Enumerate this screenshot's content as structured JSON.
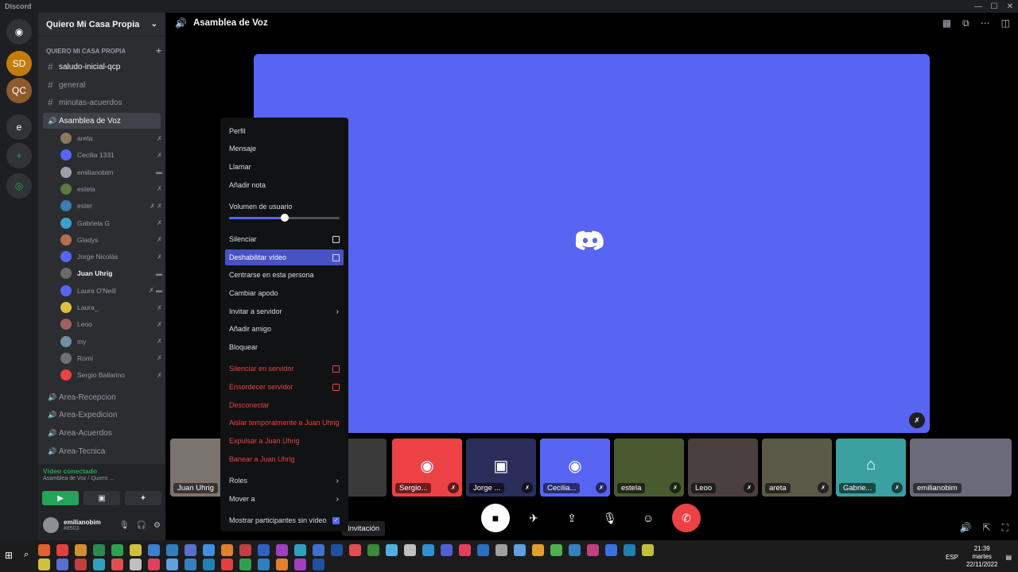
{
  "window": {
    "title": "Discord",
    "controls": [
      "—",
      "☐",
      "✕"
    ]
  },
  "guilds": [
    {
      "name": "discord-home",
      "glyph": "◉",
      "color": "#313338"
    },
    {
      "name": "server-a",
      "glyph": "SD",
      "color": "#c27c0e"
    },
    {
      "name": "server-quiero-mi-casa",
      "glyph": "QC",
      "color": "#8e5a2e"
    },
    {
      "name": "server-e",
      "glyph": "e",
      "color": "#313338"
    },
    {
      "name": "add-server",
      "glyph": "+",
      "color": "#313338"
    },
    {
      "name": "explore",
      "glyph": "◎",
      "color": "#313338"
    }
  ],
  "server": {
    "name": "Quiero Mi Casa Propia",
    "category": "QUIERO MI CASA PROPIA"
  },
  "channels": [
    {
      "name": "saludo-inicial-qcp",
      "type": "text",
      "bright": true
    },
    {
      "name": "general",
      "type": "text"
    },
    {
      "name": "minutas-acuerdos",
      "type": "text"
    },
    {
      "name": "Asamblea de Voz",
      "type": "voice",
      "active": true
    }
  ],
  "voice_users": [
    {
      "name": "areta",
      "icon": "✗",
      "color": "#8a7a60"
    },
    {
      "name": "Cecilia 1331",
      "icon": "✗",
      "color": "#5865f2"
    },
    {
      "name": "emilianobim",
      "icon": "▬",
      "color": "#9aa0a6"
    },
    {
      "name": "estela",
      "icon": "✗",
      "color": "#5a7a40"
    },
    {
      "name": "ester",
      "icon": "✗ ✗",
      "color": "#3a7fb0"
    },
    {
      "name": "Gabriela G",
      "icon": "✗",
      "color": "#3aa0d0"
    },
    {
      "name": "Gladys",
      "icon": "✗",
      "color": "#b07050"
    },
    {
      "name": "Jorge Nicolás",
      "icon": "✗",
      "color": "#5865f2"
    },
    {
      "name": "Juan Uhrig",
      "icon": "▬",
      "color": "#6a6a6a",
      "bright": true
    },
    {
      "name": "Laura O'Neill",
      "icon": "✗ ▬",
      "color": "#5865f2"
    },
    {
      "name": "Laura_",
      "icon": "✗",
      "color": "#e0c040"
    },
    {
      "name": "Leoo",
      "icon": "✗",
      "color": "#a06060"
    },
    {
      "name": "my",
      "icon": "✗",
      "color": "#7090a0"
    },
    {
      "name": "Romi",
      "icon": "✗",
      "color": "#707070"
    },
    {
      "name": "Sergio Ballarino",
      "icon": "✗",
      "color": "#ed4245"
    }
  ],
  "voice_channels": [
    "Area-Recepcion",
    "Area-Expedicion",
    "Area-Acuerdos",
    "Area-Tecnica"
  ],
  "voice_status": {
    "label": "Vídeo conectado",
    "sub": "Asamblea de Voz / Quiero ..."
  },
  "user": {
    "name": "emilianobim",
    "tag": "#8503"
  },
  "main": {
    "channel_title": "Asamblea de Voz",
    "invite_label": "Invitación"
  },
  "tiles": [
    {
      "label": "Juan Uhrig",
      "bg": "#7a7470",
      "glyph": ""
    },
    {
      "label": "...",
      "bg": "#3a3a3a",
      "glyph": ""
    },
    {
      "label": "Sergio...",
      "bg": "#ed4245",
      "glyph": "◉"
    },
    {
      "label": "Jorge ...",
      "bg": "#2b2d5a",
      "glyph": "▣"
    },
    {
      "label": "Cecilia...",
      "bg": "#5865f2",
      "glyph": "◉"
    },
    {
      "label": "estela",
      "bg": "#4a5a30",
      "glyph": ""
    },
    {
      "label": "Leoo",
      "bg": "#4a4040",
      "glyph": ""
    },
    {
      "label": "areta",
      "bg": "#5a5a48",
      "glyph": ""
    },
    {
      "label": "Gabrie...",
      "bg": "#3aa0a0",
      "glyph": "⌂"
    },
    {
      "label": "emilianobim",
      "bg": "#6a6a7a",
      "glyph": ""
    }
  ],
  "context_menu": {
    "items": [
      {
        "label": "Perfil"
      },
      {
        "label": "Mensaje"
      },
      {
        "label": "Llamar"
      },
      {
        "label": "Añadir nota"
      }
    ],
    "volume_label": "Volumen de usuario",
    "volume_level": 0.5,
    "items2": [
      {
        "label": "Silenciar",
        "check": true
      },
      {
        "label": "Deshabilitar vídeo",
        "check": true,
        "highlight": true
      },
      {
        "label": "Centrarse en esta persona"
      },
      {
        "label": "Cambiar apodo"
      },
      {
        "label": "Invitar a servidor",
        "arrow": true
      },
      {
        "label": "Añadir amigo"
      },
      {
        "label": "Bloquear"
      }
    ],
    "danger": [
      {
        "label": "Silenciar en servidor",
        "check": true
      },
      {
        "label": "Ensordecer servidor",
        "check": true
      },
      {
        "label": "Desconectar"
      },
      {
        "label": "Aislar temporalmente a Juan Uhrig"
      },
      {
        "label": "Expulsar a Juan Uhrig"
      },
      {
        "label": "Banear a Juan Uhrig"
      }
    ],
    "tail": [
      {
        "label": "Roles",
        "arrow": true
      },
      {
        "label": "Mover a",
        "arrow": true
      },
      {
        "label": "Mostrar participantes sin vídeo",
        "checked": true
      }
    ]
  },
  "taskbar": {
    "lang": "ESP",
    "time": "21:39",
    "day": "martes",
    "date": "22/11/2022"
  },
  "colors": {
    "blurple": "#5865f2",
    "red": "#ed4245",
    "green": "#23a559"
  }
}
